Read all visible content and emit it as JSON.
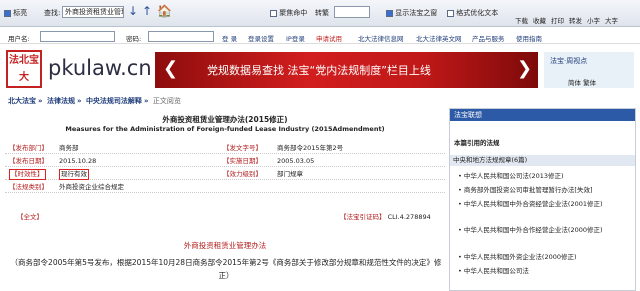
{
  "toolbar": {
    "marks": "标亮",
    "search_label": "查找:",
    "search_value": "外商投资租赁业管理",
    "prev": "↓",
    "next": "↑",
    "home": "🏠",
    "focus": "聚焦命中",
    "convert": "转繁",
    "fulltext": "显示法宝之窗",
    "format": "格式优化文本",
    "right": [
      "下载",
      "收藏",
      "打印",
      "转发",
      "小字",
      "大字"
    ]
  },
  "login": {
    "user": "用户名:",
    "pwd": "密码:",
    "links": [
      "登 录",
      "登录设置",
      "IP登录",
      "申请试用",
      "北大法律信息网",
      "北大法律英文网",
      "产品与服务",
      "使用指南"
    ]
  },
  "header": {
    "logo": "法北宝大",
    "site": "pkulaw.cn",
    "banner": "党规数据易查找 法宝“党内法规制度”栏目上线",
    "fb_label": "法宝·周视点",
    "lang": "简体 繁体"
  },
  "breadcrumb": [
    "北大法宝",
    "法律法规",
    "中央法规司法解释",
    "正文阅览"
  ],
  "doc": {
    "title_cn": "外商投资租赁业管理办法(2015修正)",
    "title_en": "Measures for the Administration of Foreign-funded Lease Industry (2015Admendment)",
    "rows": [
      {
        "l1": "【发布部门】",
        "v1": "商务部",
        "l2": "【发文字号】",
        "v2": "商务部令2015年第2号"
      },
      {
        "l1": "【发布日期】",
        "v1": "2015.10.28",
        "l2": "【实施日期】",
        "v2": "2005.03.05"
      },
      {
        "l1": "【时效性】",
        "v1": "现行有效",
        "l2": "【效力级别】",
        "v2": "部门规章"
      },
      {
        "l1": "【法规类别】",
        "v1": "外商投资企业综合规定",
        "l2": "",
        "v2": ""
      }
    ],
    "fulltext_label": "【全文】",
    "code_label": "【法宝引证码】",
    "code": "CLI.4.278894",
    "subtitle": "外商投资租赁业管理办法",
    "para": "（商务部令2005年第5号发布，根据2015年10月28日商务部令2015年第2号《商务部关于修改部分规章和规范性文件的决定》修正）"
  },
  "side": {
    "header": "法宝联想",
    "sub": "本篇引用的法规",
    "cat": "中央和地方法规规章(6篇)",
    "items": [
      "中华人民共和国公司法(2013修正)",
      "商务部外国投资公司审批管理暂行办法[失效]",
      "中华人民共和国中外合资经营企业法(2001修正)",
      "中华人民共和国中外合作经营企业法(2000修正)",
      "中华人民共和国外资企业法(2000修正)",
      "中华人民共和国公司法"
    ]
  }
}
